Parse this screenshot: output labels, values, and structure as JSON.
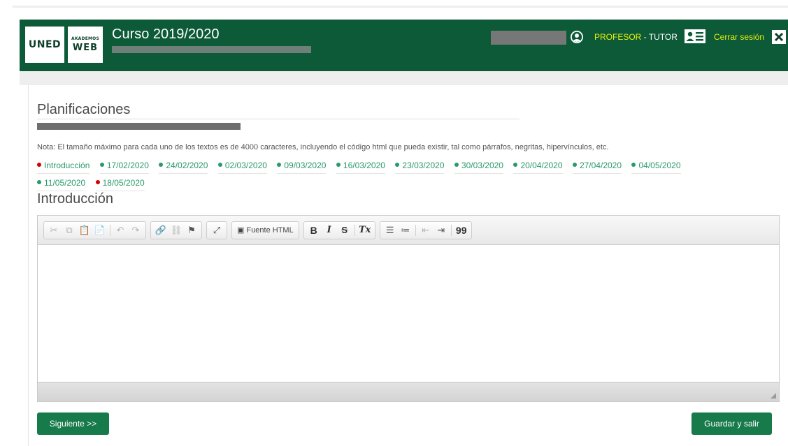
{
  "header": {
    "logo_main": "UNED",
    "logo_sub_small": "AKADEMOS",
    "logo_sub_big": "WEB",
    "course_title": "Curso 2019/2020",
    "role_label": "PROFESOR",
    "role_separator": " - TUTOR",
    "logout_label": "Cerrar sesión",
    "icons": {
      "user": "user-circle-icon",
      "card": "id-card-icon",
      "close": "close-icon"
    },
    "colors": {
      "header_bg": "#0c5a38",
      "accent_yellow": "#e8f20a"
    }
  },
  "main": {
    "title": "Planificaciones",
    "note": "Nota: El tamaño máximo para cada uno de los textos es de 4000 caracteres, incluyendo el código html que pueda existir, tal como párrafos, negritas, hipervínculos, etc.",
    "dates": [
      {
        "label": "Introducción",
        "status": "red"
      },
      {
        "label": "17/02/2020",
        "status": "green"
      },
      {
        "label": "24/02/2020",
        "status": "green"
      },
      {
        "label": "02/03/2020",
        "status": "green"
      },
      {
        "label": "09/03/2020",
        "status": "green"
      },
      {
        "label": "16/03/2020",
        "status": "green"
      },
      {
        "label": "23/03/2020",
        "status": "green"
      },
      {
        "label": "30/03/2020",
        "status": "green"
      },
      {
        "label": "20/04/2020",
        "status": "green"
      },
      {
        "label": "27/04/2020",
        "status": "green"
      },
      {
        "label": "04/05/2020",
        "status": "green"
      },
      {
        "label": "11/05/2020",
        "status": "green"
      },
      {
        "label": "18/05/2020",
        "status": "red"
      }
    ],
    "section_title": "Introducción"
  },
  "editor": {
    "source_button_label": "Fuente HTML",
    "bold_glyph": "B",
    "italic_glyph": "I",
    "strike_glyph": "S",
    "clear_format_glyph": "Tx",
    "quote_glyph": "99"
  },
  "actions": {
    "next_label": "Siguiente >>",
    "save_label": "Guardar y salir",
    "button_color": "#177a4a"
  }
}
